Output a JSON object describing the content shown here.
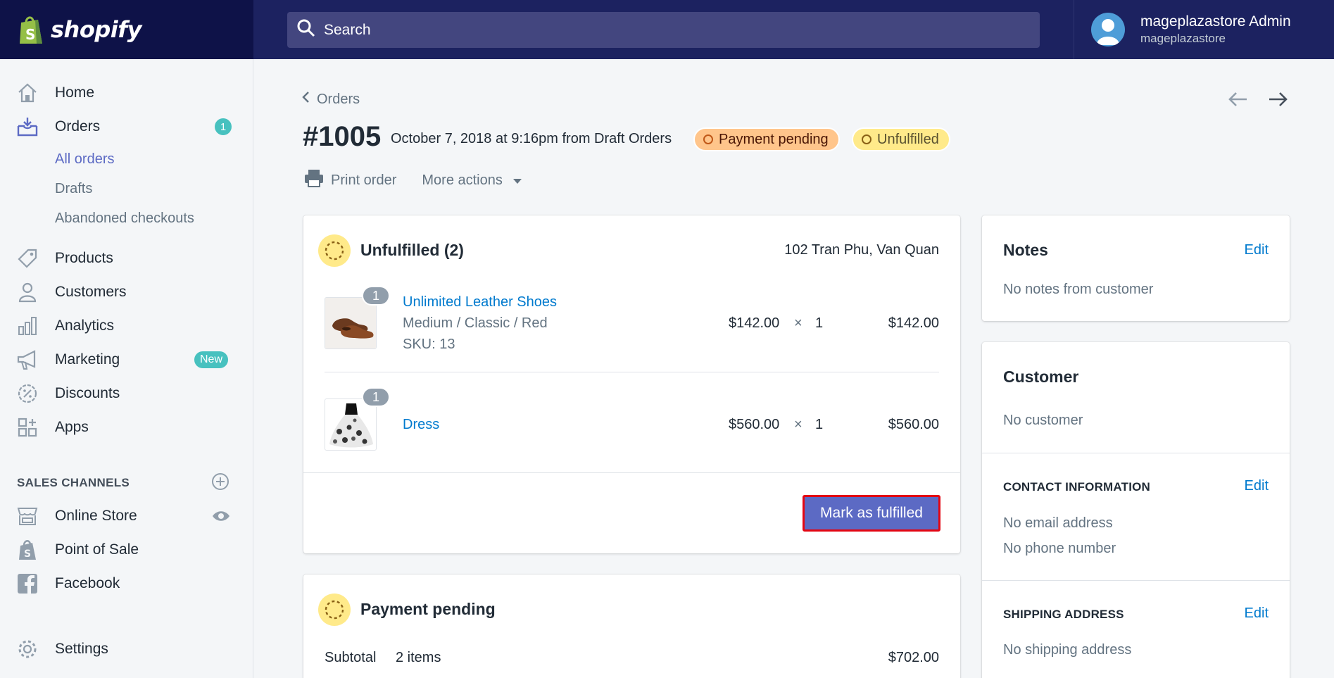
{
  "brand": {
    "name": "shopify"
  },
  "search": {
    "placeholder": "Search"
  },
  "user": {
    "name": "mageplazastore Admin",
    "store": "mageplazastore"
  },
  "sidebar": {
    "items": [
      {
        "label": "Home",
        "icon": "home-icon"
      },
      {
        "label": "Orders",
        "icon": "orders-icon",
        "badge": "1"
      },
      {
        "label": "Products",
        "icon": "tag-icon"
      },
      {
        "label": "Customers",
        "icon": "person-icon"
      },
      {
        "label": "Analytics",
        "icon": "bar-chart-icon"
      },
      {
        "label": "Marketing",
        "icon": "megaphone-icon",
        "badge": "New"
      },
      {
        "label": "Discounts",
        "icon": "discount-icon"
      },
      {
        "label": "Apps",
        "icon": "apps-icon"
      }
    ],
    "order_subitems": [
      "All orders",
      "Drafts",
      "Abandoned checkouts"
    ],
    "sales_channels_title": "SALES CHANNELS",
    "channels": [
      {
        "label": "Online Store",
        "icon": "store-icon"
      },
      {
        "label": "Point of Sale",
        "icon": "pos-icon"
      },
      {
        "label": "Facebook",
        "icon": "facebook-icon"
      }
    ],
    "settings": "Settings"
  },
  "order": {
    "breadcrumb": "Orders",
    "number": "#1005",
    "meta": "October 7, 2018 at 9:16pm from Draft Orders",
    "payment_status": "Payment pending",
    "fulfillment_status": "Unfulfilled",
    "print": "Print order",
    "more_actions": "More actions"
  },
  "unfulfilled": {
    "title": "Unfulfilled (2)",
    "address": "102 Tran Phu, Van Quan",
    "items": [
      {
        "qty_badge": "1",
        "name": "Unlimited Leather Shoes",
        "variant": "Medium / Classic / Red",
        "sku": "SKU: 13",
        "price": "$142.00",
        "times": "×",
        "qty": "1",
        "total": "$142.00"
      },
      {
        "qty_badge": "1",
        "name": "Dress",
        "price": "$560.00",
        "times": "×",
        "qty": "1",
        "total": "$560.00"
      }
    ],
    "button": "Mark as fulfilled"
  },
  "payment": {
    "title": "Payment pending",
    "subtotal_label": "Subtotal",
    "subtotal_items": "2 items",
    "subtotal_value": "$702.00"
  },
  "notes": {
    "title": "Notes",
    "edit": "Edit",
    "text": "No notes from customer"
  },
  "customer": {
    "title": "Customer",
    "text": "No customer",
    "contact_title": "CONTACT INFORMATION",
    "contact_edit": "Edit",
    "email": "No email address",
    "phone": "No phone number",
    "shipping_title": "SHIPPING ADDRESS",
    "shipping_edit": "Edit",
    "shipping_text": "No shipping address"
  },
  "colors": {
    "topbar": "#1c2260",
    "logo_bg": "#0e1248",
    "accent": "#5c6ac4",
    "link": "#007ace",
    "teal": "#47c1bf"
  }
}
